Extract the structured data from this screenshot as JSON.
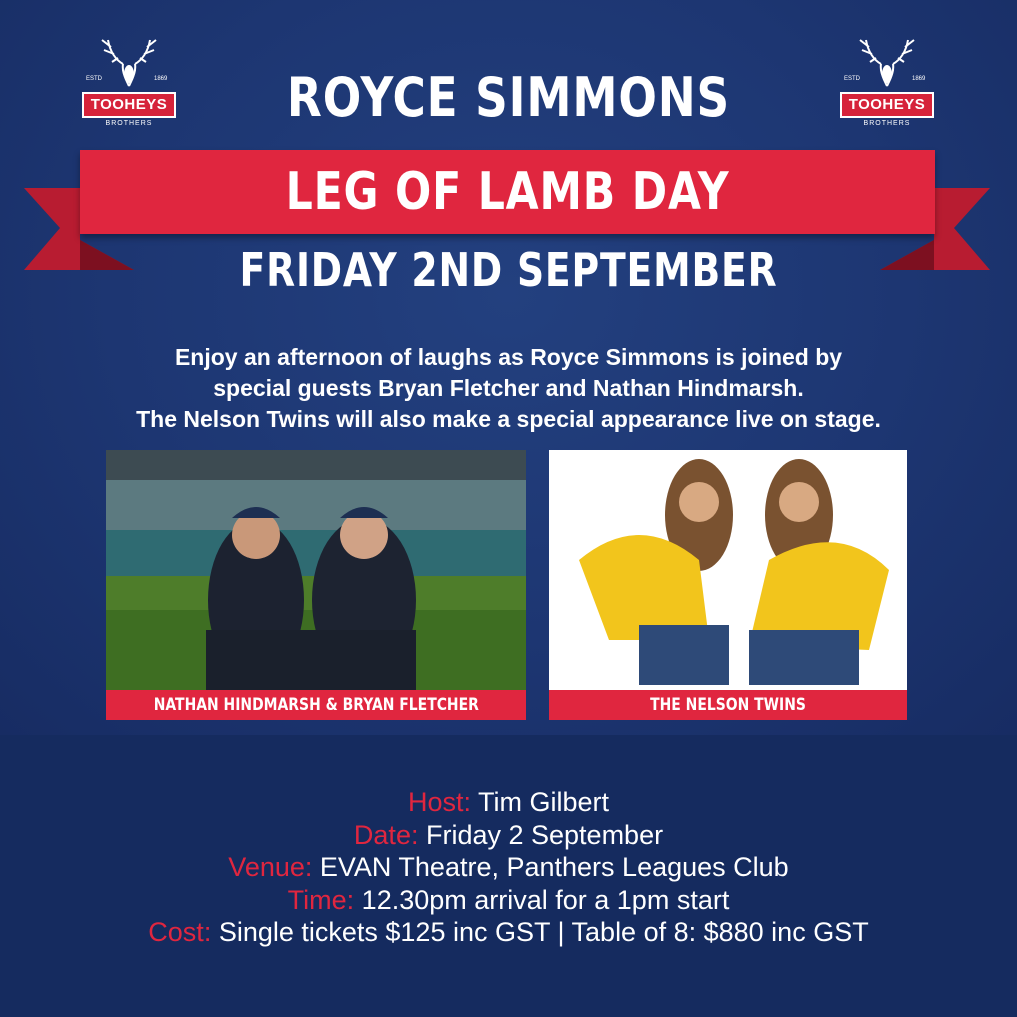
{
  "logos": {
    "brand": "TOOHEYS",
    "sub": "BROTHERS",
    "estd_left": "ESTD",
    "estd_right": "1869"
  },
  "header": {
    "title": "ROYCE SIMMONS",
    "banner": "LEG OF LAMB DAY",
    "date": "FRIDAY 2ND SEPTEMBER"
  },
  "intro": {
    "line1": "Enjoy an afternoon of laughs as Royce Simmons is joined by",
    "line2": "special guests Bryan Fletcher and Nathan Hindmarsh.",
    "line3": "The Nelson Twins will also make a special appearance live on stage."
  },
  "photos": {
    "left_caption": "NATHAN HINDMARSH & BRYAN FLETCHER",
    "right_caption": "THE NELSON TWINS"
  },
  "details": {
    "host_label": "Host:",
    "host_value": " Tim Gilbert",
    "date_label": "Date:",
    "date_value": " Friday 2 September",
    "venue_label": "Venue:",
    "venue_value": " EVAN Theatre, Panthers Leagues Club",
    "time_label": "Time:",
    "time_value": " 12.30pm arrival for a 1pm start",
    "cost_label": "Cost:",
    "cost_value": " Single tickets $125 inc GST | Table of 8: $880 inc GST"
  },
  "colors": {
    "accent": "#e0263f",
    "background": "#1c3470",
    "text": "#ffffff"
  }
}
